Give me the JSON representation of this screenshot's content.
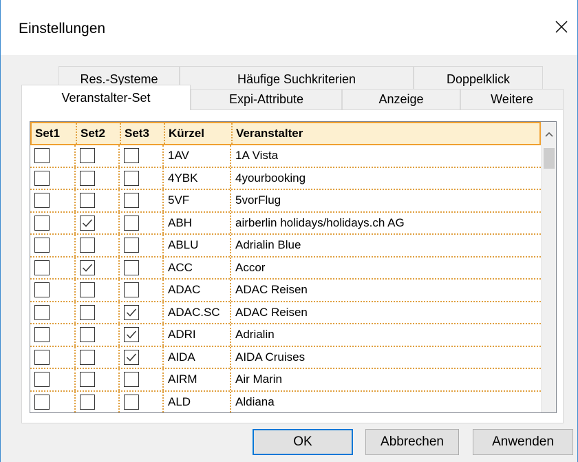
{
  "window": {
    "title": "Einstellungen"
  },
  "tabs": {
    "row_top": [
      "Res.-Systeme",
      "Häufige Suchkriterien",
      "Doppelklick"
    ],
    "row_bottom": [
      "Veranstalter-Set",
      "Expi-Attribute",
      "Anzeige",
      "Weitere"
    ],
    "selected": "Veranstalter-Set"
  },
  "table": {
    "columns": [
      "Set1",
      "Set2",
      "Set3",
      "Kürzel",
      "Veranstalter"
    ],
    "rows": [
      {
        "set1": false,
        "set2": false,
        "set3": false,
        "code": "1AV",
        "name": "1A Vista"
      },
      {
        "set1": false,
        "set2": false,
        "set3": false,
        "code": "4YBK",
        "name": "4yourbooking"
      },
      {
        "set1": false,
        "set2": false,
        "set3": false,
        "code": "5VF",
        "name": "5vorFlug"
      },
      {
        "set1": false,
        "set2": true,
        "set3": false,
        "code": "ABH",
        "name": "airberlin holidays/holidays.ch AG"
      },
      {
        "set1": false,
        "set2": false,
        "set3": false,
        "code": "ABLU",
        "name": "Adrialin Blue"
      },
      {
        "set1": false,
        "set2": true,
        "set3": false,
        "code": "ACC",
        "name": "Accor"
      },
      {
        "set1": false,
        "set2": false,
        "set3": false,
        "code": "ADAC",
        "name": "ADAC Reisen"
      },
      {
        "set1": false,
        "set2": false,
        "set3": true,
        "code": "ADAC.SC",
        "name": "ADAC Reisen"
      },
      {
        "set1": false,
        "set2": false,
        "set3": true,
        "code": "ADRI",
        "name": "Adrialin"
      },
      {
        "set1": false,
        "set2": false,
        "set3": true,
        "code": "AIDA",
        "name": "AIDA Cruises"
      },
      {
        "set1": false,
        "set2": false,
        "set3": false,
        "code": "AIRM",
        "name": "Air Marin"
      },
      {
        "set1": false,
        "set2": false,
        "set3": false,
        "code": "ALD",
        "name": "Aldiana"
      }
    ]
  },
  "buttons": {
    "ok": "OK",
    "cancel": "Abbrechen",
    "apply": "Anwenden"
  },
  "colors": {
    "header_bg": "#fdf0d0",
    "grid_line": "#e0a040",
    "default_button_border": "#0078d7",
    "window_border": "#3c8ad0"
  },
  "icons": {
    "close": "close-icon",
    "scroll_up": "chevron-up-icon",
    "check": "checkmark-icon"
  }
}
